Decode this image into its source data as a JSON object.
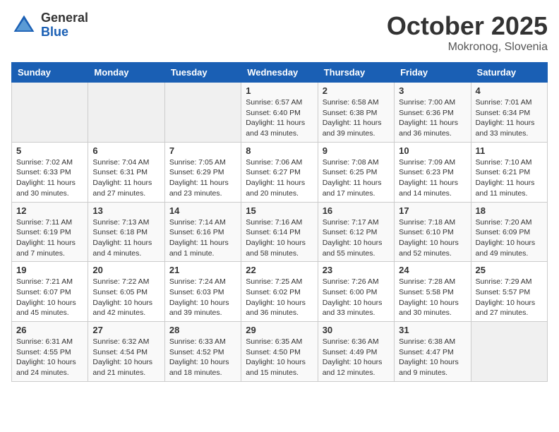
{
  "header": {
    "logo_general": "General",
    "logo_blue": "Blue",
    "month_title": "October 2025",
    "location": "Mokronog, Slovenia"
  },
  "days_of_week": [
    "Sunday",
    "Monday",
    "Tuesday",
    "Wednesday",
    "Thursday",
    "Friday",
    "Saturday"
  ],
  "weeks": [
    [
      {
        "day": "",
        "info": ""
      },
      {
        "day": "",
        "info": ""
      },
      {
        "day": "",
        "info": ""
      },
      {
        "day": "1",
        "info": "Sunrise: 6:57 AM\nSunset: 6:40 PM\nDaylight: 11 hours\nand 43 minutes."
      },
      {
        "day": "2",
        "info": "Sunrise: 6:58 AM\nSunset: 6:38 PM\nDaylight: 11 hours\nand 39 minutes."
      },
      {
        "day": "3",
        "info": "Sunrise: 7:00 AM\nSunset: 6:36 PM\nDaylight: 11 hours\nand 36 minutes."
      },
      {
        "day": "4",
        "info": "Sunrise: 7:01 AM\nSunset: 6:34 PM\nDaylight: 11 hours\nand 33 minutes."
      }
    ],
    [
      {
        "day": "5",
        "info": "Sunrise: 7:02 AM\nSunset: 6:33 PM\nDaylight: 11 hours\nand 30 minutes."
      },
      {
        "day": "6",
        "info": "Sunrise: 7:04 AM\nSunset: 6:31 PM\nDaylight: 11 hours\nand 27 minutes."
      },
      {
        "day": "7",
        "info": "Sunrise: 7:05 AM\nSunset: 6:29 PM\nDaylight: 11 hours\nand 23 minutes."
      },
      {
        "day": "8",
        "info": "Sunrise: 7:06 AM\nSunset: 6:27 PM\nDaylight: 11 hours\nand 20 minutes."
      },
      {
        "day": "9",
        "info": "Sunrise: 7:08 AM\nSunset: 6:25 PM\nDaylight: 11 hours\nand 17 minutes."
      },
      {
        "day": "10",
        "info": "Sunrise: 7:09 AM\nSunset: 6:23 PM\nDaylight: 11 hours\nand 14 minutes."
      },
      {
        "day": "11",
        "info": "Sunrise: 7:10 AM\nSunset: 6:21 PM\nDaylight: 11 hours\nand 11 minutes."
      }
    ],
    [
      {
        "day": "12",
        "info": "Sunrise: 7:11 AM\nSunset: 6:19 PM\nDaylight: 11 hours\nand 7 minutes."
      },
      {
        "day": "13",
        "info": "Sunrise: 7:13 AM\nSunset: 6:18 PM\nDaylight: 11 hours\nand 4 minutes."
      },
      {
        "day": "14",
        "info": "Sunrise: 7:14 AM\nSunset: 6:16 PM\nDaylight: 11 hours\nand 1 minute."
      },
      {
        "day": "15",
        "info": "Sunrise: 7:16 AM\nSunset: 6:14 PM\nDaylight: 10 hours\nand 58 minutes."
      },
      {
        "day": "16",
        "info": "Sunrise: 7:17 AM\nSunset: 6:12 PM\nDaylight: 10 hours\nand 55 minutes."
      },
      {
        "day": "17",
        "info": "Sunrise: 7:18 AM\nSunset: 6:10 PM\nDaylight: 10 hours\nand 52 minutes."
      },
      {
        "day": "18",
        "info": "Sunrise: 7:20 AM\nSunset: 6:09 PM\nDaylight: 10 hours\nand 49 minutes."
      }
    ],
    [
      {
        "day": "19",
        "info": "Sunrise: 7:21 AM\nSunset: 6:07 PM\nDaylight: 10 hours\nand 45 minutes."
      },
      {
        "day": "20",
        "info": "Sunrise: 7:22 AM\nSunset: 6:05 PM\nDaylight: 10 hours\nand 42 minutes."
      },
      {
        "day": "21",
        "info": "Sunrise: 7:24 AM\nSunset: 6:03 PM\nDaylight: 10 hours\nand 39 minutes."
      },
      {
        "day": "22",
        "info": "Sunrise: 7:25 AM\nSunset: 6:02 PM\nDaylight: 10 hours\nand 36 minutes."
      },
      {
        "day": "23",
        "info": "Sunrise: 7:26 AM\nSunset: 6:00 PM\nDaylight: 10 hours\nand 33 minutes."
      },
      {
        "day": "24",
        "info": "Sunrise: 7:28 AM\nSunset: 5:58 PM\nDaylight: 10 hours\nand 30 minutes."
      },
      {
        "day": "25",
        "info": "Sunrise: 7:29 AM\nSunset: 5:57 PM\nDaylight: 10 hours\nand 27 minutes."
      }
    ],
    [
      {
        "day": "26",
        "info": "Sunrise: 6:31 AM\nSunset: 4:55 PM\nDaylight: 10 hours\nand 24 minutes."
      },
      {
        "day": "27",
        "info": "Sunrise: 6:32 AM\nSunset: 4:54 PM\nDaylight: 10 hours\nand 21 minutes."
      },
      {
        "day": "28",
        "info": "Sunrise: 6:33 AM\nSunset: 4:52 PM\nDaylight: 10 hours\nand 18 minutes."
      },
      {
        "day": "29",
        "info": "Sunrise: 6:35 AM\nSunset: 4:50 PM\nDaylight: 10 hours\nand 15 minutes."
      },
      {
        "day": "30",
        "info": "Sunrise: 6:36 AM\nSunset: 4:49 PM\nDaylight: 10 hours\nand 12 minutes."
      },
      {
        "day": "31",
        "info": "Sunrise: 6:38 AM\nSunset: 4:47 PM\nDaylight: 10 hours\nand 9 minutes."
      },
      {
        "day": "",
        "info": ""
      }
    ]
  ]
}
